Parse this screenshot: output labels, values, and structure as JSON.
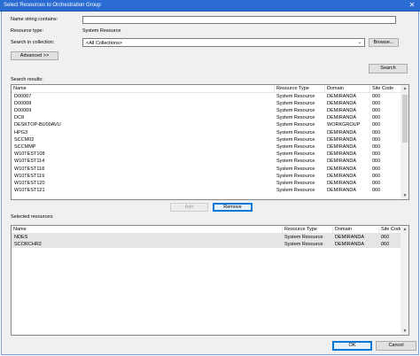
{
  "window": {
    "title": "Select Resources to Orchestration Group",
    "close_glyph": "✕"
  },
  "form": {
    "name_label": "Name string contains:",
    "name_value": "",
    "type_label": "Resource type:",
    "type_value": "System Resource",
    "collection_label": "Search in collection:",
    "collection_value": "<All Collections>",
    "browse_label": "Browse...",
    "advanced_label": "Advanced >>",
    "search_label": "Search"
  },
  "search_results": {
    "label": "Search results:",
    "columns": [
      "Name",
      "Resource Type",
      "Domain",
      "Site Code"
    ],
    "rows": [
      [
        "D00007",
        "System Resource",
        "DEMIRANDA",
        "060"
      ],
      [
        "D00008",
        "System Resource",
        "DEMIRANDA",
        "060"
      ],
      [
        "D00009",
        "System Resource",
        "DEMIRANDA",
        "060"
      ],
      [
        "DC8",
        "System Resource",
        "DEMIRANDA",
        "060"
      ],
      [
        "DESKTOP-BU00AVU",
        "System Resource",
        "WORKGROUP",
        "060"
      ],
      [
        "HPG3",
        "System Resource",
        "DEMIRANDA",
        "060"
      ],
      [
        "SCCM02",
        "System Resource",
        "DEMIRANDA",
        "060"
      ],
      [
        "SCCMMP",
        "System Resource",
        "DEMIRANDA",
        "060"
      ],
      [
        "W10TEST108",
        "System Resource",
        "DEMIRANDA",
        "060"
      ],
      [
        "W10TEST114",
        "System Resource",
        "DEMIRANDA",
        "060"
      ],
      [
        "W10TEST118",
        "System Resource",
        "DEMIRANDA",
        "060"
      ],
      [
        "W10TEST119",
        "System Resource",
        "DEMIRANDA",
        "060"
      ],
      [
        "W10TEST120",
        "System Resource",
        "DEMIRANDA",
        "060"
      ],
      [
        "W10TEST121",
        "System Resource",
        "DEMIRANDA",
        "060"
      ]
    ]
  },
  "actions": {
    "add_label": "Add",
    "remove_label": "Remove"
  },
  "selected_resources": {
    "label": "Selected resources:",
    "columns": [
      "Name",
      "Resource Type",
      "Domain",
      "Site Code"
    ],
    "rows": [
      [
        "NDES",
        "System Resource",
        "DEMIRANDA",
        "060"
      ],
      [
        "SCORCHR2",
        "System Resource",
        "DEMIRANDA",
        "060"
      ]
    ]
  },
  "footer": {
    "ok_label": "OK",
    "cancel_label": "Cancel"
  },
  "icons": {
    "scroll_up": "▲",
    "scroll_down": "▼",
    "dropdown": "⌄"
  },
  "colors": {
    "titlebar": "#2b6cd2",
    "focus_border": "#0078d7",
    "selected_row": "#e5e5e5"
  }
}
